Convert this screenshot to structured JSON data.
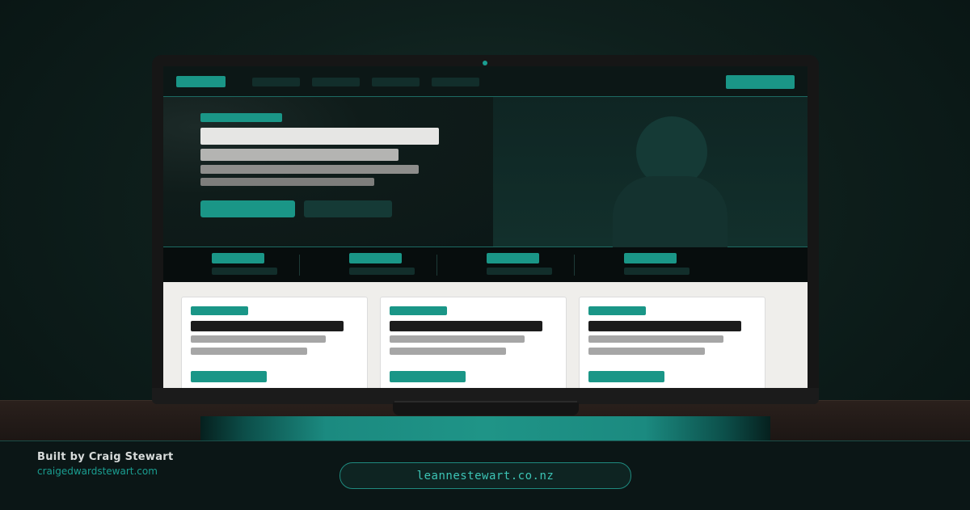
{
  "footer": {
    "built_by": "Built by Craig Stewart",
    "built_by_url": "craigedwardstewart.com",
    "site_url": "leannestewart.co.nz"
  },
  "colors": {
    "accent": "#1a9687",
    "background": "#0e1f1c",
    "card_bg": "#ffffff"
  },
  "icons": {
    "avatar": "person-silhouette-icon",
    "camera": "webcam-dot-icon"
  }
}
